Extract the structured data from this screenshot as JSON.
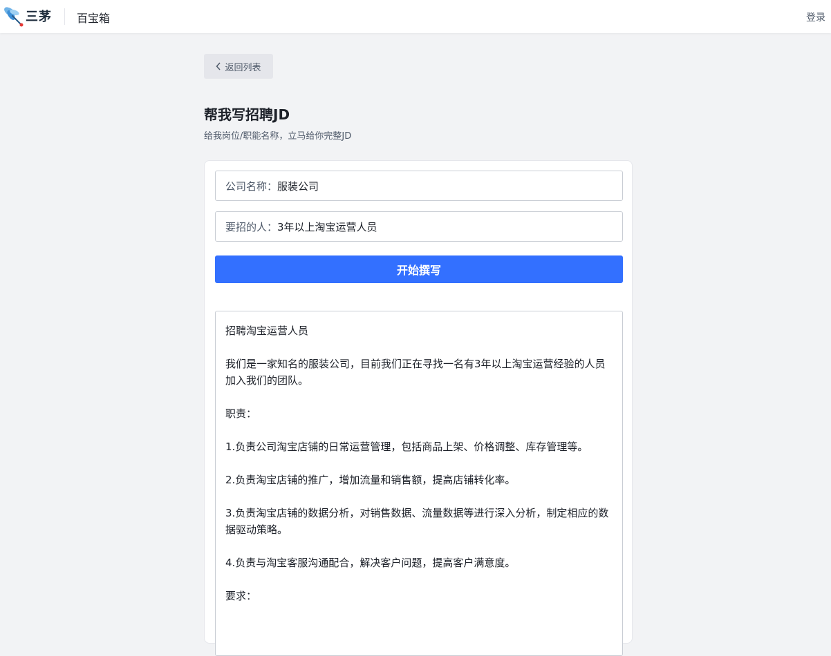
{
  "header": {
    "brand": "三茅",
    "nav_label": "百宝箱",
    "login_label": "登录"
  },
  "back_label": "返回列表",
  "page": {
    "title": "帮我写招聘JD",
    "subtitle": "给我岗位/职能名称，立马给你完整JD"
  },
  "form": {
    "company_label": "公司名称：",
    "company_value": "服装公司",
    "person_label": "要招的人：",
    "person_value": "3年以上淘宝运营人员",
    "submit_label": "开始撰写"
  },
  "result": {
    "paragraphs": [
      "招聘淘宝运营人员",
      "我们是一家知名的服装公司，目前我们正在寻找一名有3年以上淘宝运营经验的人员加入我们的团队。",
      "职责：",
      "1.负责公司淘宝店铺的日常运营管理，包括商品上架、价格调整、库存管理等。",
      "2.负责淘宝店铺的推广，增加流量和销售额，提高店铺转化率。",
      "3.负责淘宝店铺的数据分析，对销售数据、流量数据等进行深入分析，制定相应的数据驱动策略。",
      "4.负责与淘宝客服沟通配合，解决客户问题，提高客户满意度。",
      "要求："
    ]
  },
  "colors": {
    "primary": "#3370ff",
    "background": "#f2f3f5"
  }
}
